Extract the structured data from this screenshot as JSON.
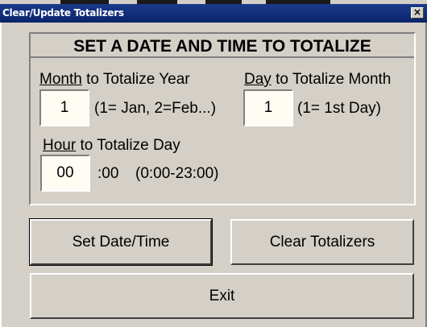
{
  "window": {
    "title": "Clear/Update Totalizers",
    "close_glyph": "×"
  },
  "panel": {
    "heading": "SET A DATE AND TIME TO TOTALIZE"
  },
  "month": {
    "label_underlined": "Month",
    "label_rest": " to Totalize Year",
    "value": "1",
    "hint": "(1= Jan, 2=Feb...)"
  },
  "day": {
    "label_underlined": "Day",
    "label_rest": " to Totalize Month",
    "value": "1",
    "hint": "(1= 1st Day)"
  },
  "hour": {
    "label_underlined": "Hour",
    "label_rest": " to Totalize Day",
    "value": "00",
    "suffix": ":00",
    "hint": "(0:00-23:00)"
  },
  "buttons": {
    "set_datetime": "Set Date/Time",
    "clear_totalizers": "Clear Totalizers",
    "exit": "Exit"
  },
  "icons": {
    "close": "close-icon"
  }
}
